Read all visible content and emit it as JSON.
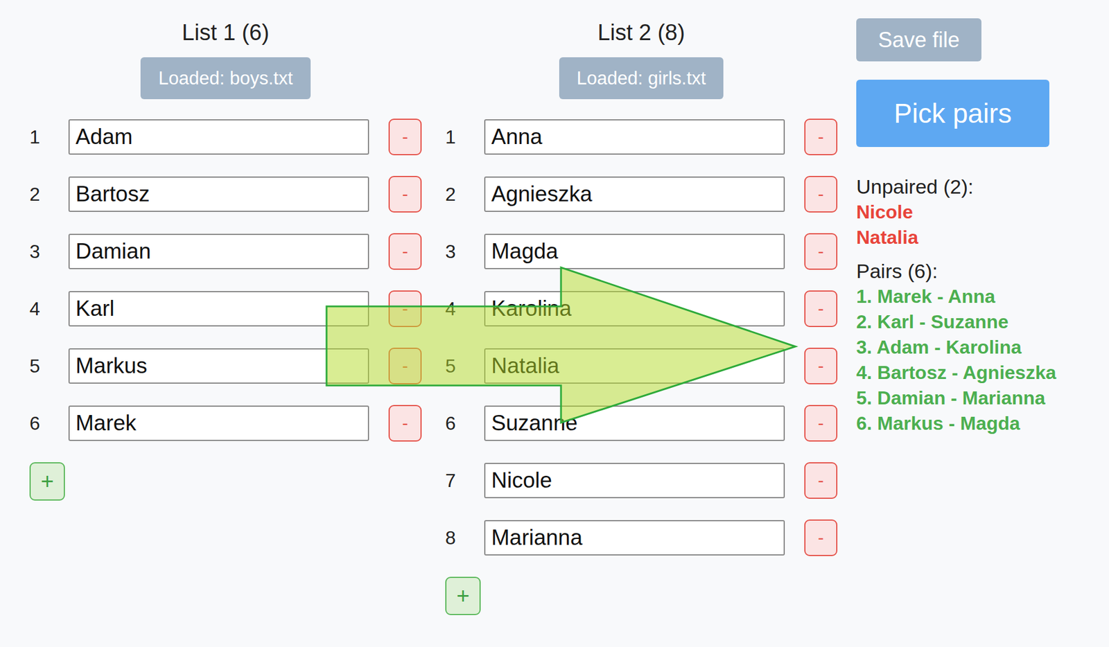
{
  "lists": [
    {
      "title": "List 1 (6)",
      "loaded": "Loaded: boys.txt",
      "remove_label": "-",
      "add_label": "+",
      "items": [
        {
          "number": "1",
          "name": "Adam"
        },
        {
          "number": "2",
          "name": "Bartosz"
        },
        {
          "number": "3",
          "name": "Damian"
        },
        {
          "number": "4",
          "name": "Karl"
        },
        {
          "number": "5",
          "name": "Markus"
        },
        {
          "number": "6",
          "name": "Marek"
        }
      ]
    },
    {
      "title": "List 2 (8)",
      "loaded": "Loaded: girls.txt",
      "remove_label": "-",
      "add_label": "+",
      "items": [
        {
          "number": "1",
          "name": "Anna"
        },
        {
          "number": "2",
          "name": "Agnieszka"
        },
        {
          "number": "3",
          "name": "Magda"
        },
        {
          "number": "4",
          "name": "Karolina"
        },
        {
          "number": "5",
          "name": "Natalia"
        },
        {
          "number": "6",
          "name": "Suzanne"
        },
        {
          "number": "7",
          "name": "Nicole"
        },
        {
          "number": "8",
          "name": "Marianna"
        }
      ]
    }
  ],
  "actions": {
    "save": "Save file",
    "pick": "Pick pairs"
  },
  "unpaired": {
    "heading": "Unpaired (2):",
    "names": [
      "Nicole",
      "Natalia"
    ]
  },
  "pairs": {
    "heading": "Pairs (6):",
    "items": [
      "1. Marek - Anna",
      "2. Karl - Suzanne",
      "3. Adam - Karolina",
      "4. Bartosz - Agnieszka",
      "5. Damian - Marianna",
      "6. Markus - Magda"
    ]
  }
}
